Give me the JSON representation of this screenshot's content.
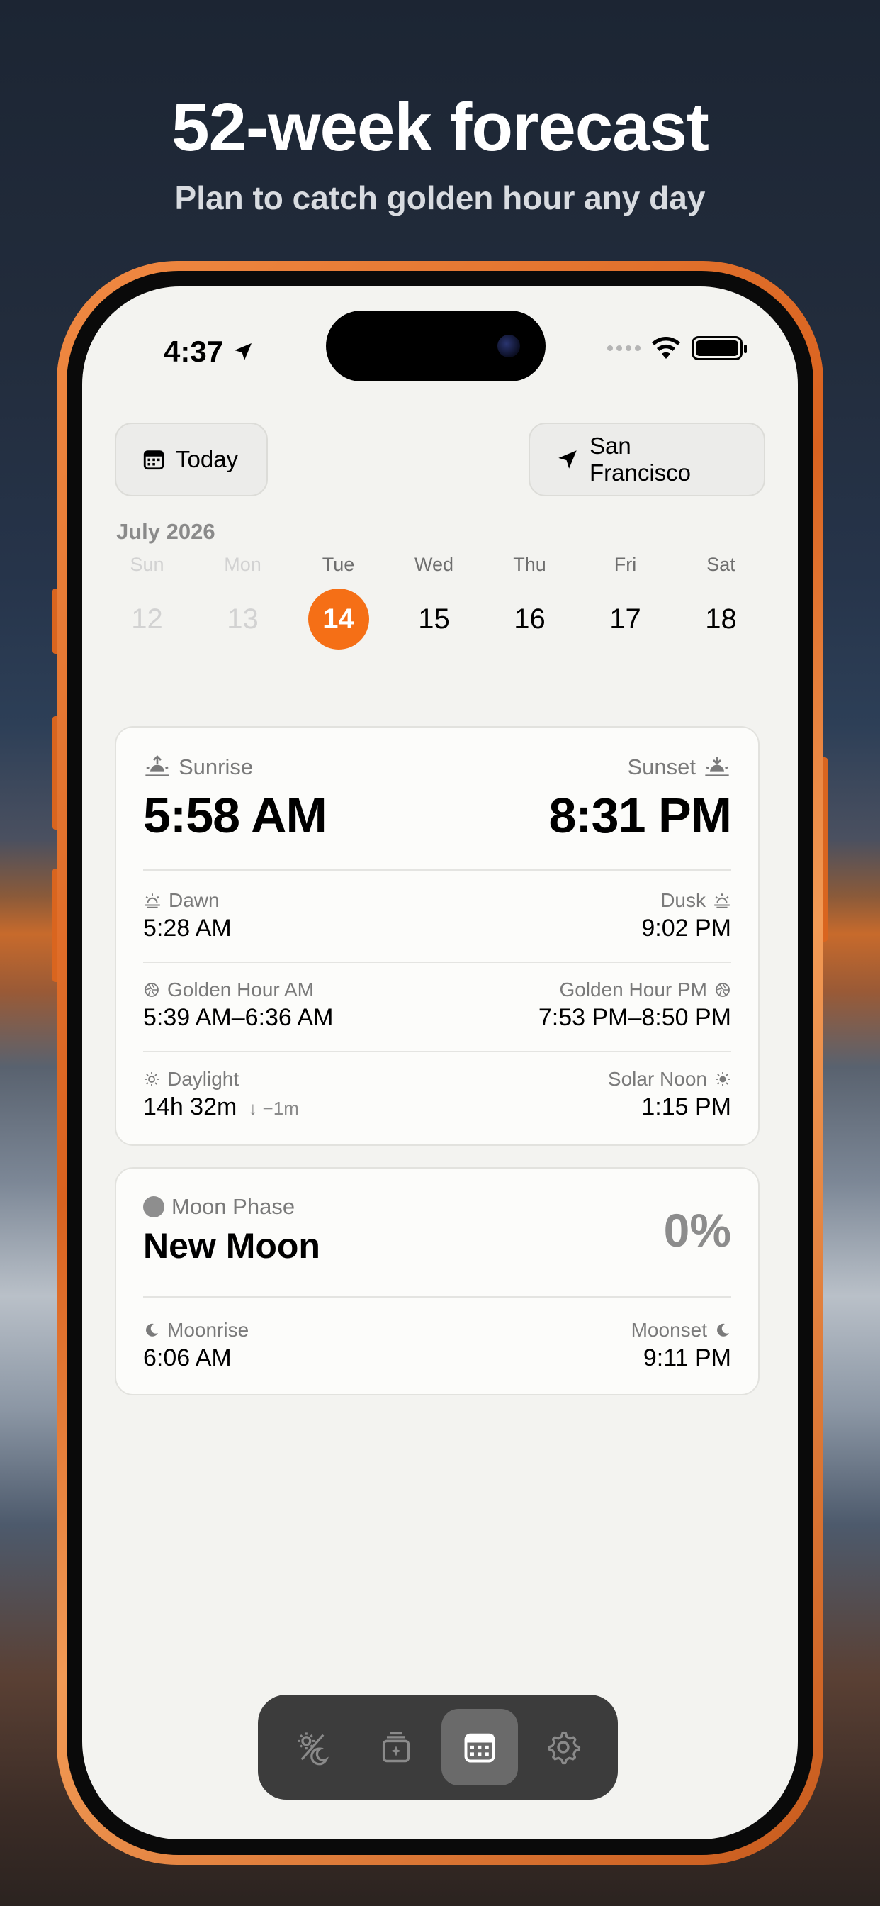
{
  "hero": {
    "title": "52-week forecast",
    "subtitle": "Plan to catch golden hour any day"
  },
  "status_bar": {
    "time": "4:37"
  },
  "header": {
    "today_label": "Today",
    "location_label": "San Francisco"
  },
  "calendar": {
    "month": "July 2026",
    "days": [
      {
        "name": "Sun",
        "num": "12",
        "state": "past"
      },
      {
        "name": "Mon",
        "num": "13",
        "state": "past"
      },
      {
        "name": "Tue",
        "num": "14",
        "state": "selected"
      },
      {
        "name": "Wed",
        "num": "15",
        "state": "normal"
      },
      {
        "name": "Thu",
        "num": "16",
        "state": "normal"
      },
      {
        "name": "Fri",
        "num": "17",
        "state": "normal"
      },
      {
        "name": "Sat",
        "num": "18",
        "state": "normal"
      }
    ]
  },
  "sun": {
    "sunrise_label": "Sunrise",
    "sunrise_time": "5:58 AM",
    "sunset_label": "Sunset",
    "sunset_time": "8:31 PM",
    "dawn_label": "Dawn",
    "dawn_time": "5:28 AM",
    "dusk_label": "Dusk",
    "dusk_time": "9:02 PM",
    "golden_am_label": "Golden Hour AM",
    "golden_am_time": "5:39 AM–6:36 AM",
    "golden_pm_label": "Golden Hour PM",
    "golden_pm_time": "7:53 PM–8:50 PM",
    "daylight_label": "Daylight",
    "daylight_value": "14h 32m",
    "daylight_delta": "↓ −1m",
    "solar_noon_label": "Solar Noon",
    "solar_noon_time": "1:15 PM"
  },
  "moon": {
    "phase_label": "Moon Phase",
    "phase_name": "New Moon",
    "illumination": "0%",
    "moonrise_label": "Moonrise",
    "moonrise_time": "6:06 AM",
    "moonset_label": "Moonset",
    "moonset_time": "9:11 PM"
  },
  "tabbar": {
    "tabs": [
      {
        "icon": "sun-moon-icon",
        "active": false
      },
      {
        "icon": "photo-stack-icon",
        "active": false
      },
      {
        "icon": "calendar-icon",
        "active": true
      },
      {
        "icon": "gear-icon",
        "active": false
      }
    ]
  },
  "colors": {
    "accent": "#f56f16",
    "frame": "#e5732b",
    "screen_bg": "#f3f3f0"
  }
}
